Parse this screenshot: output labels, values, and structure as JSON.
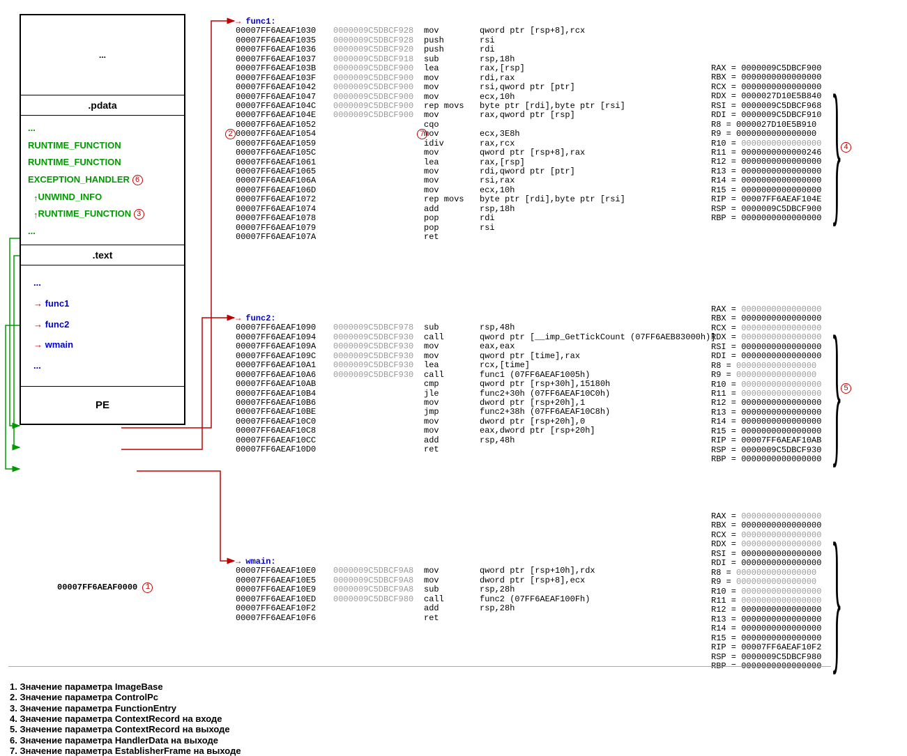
{
  "pe": {
    "dots": "...",
    "pdata_header": ".pdata",
    "pdata_items": [
      "...",
      "RUNTIME_FUNCTION",
      "RUNTIME_FUNCTION",
      "EXCEPTION_HANDLER",
      "UNWIND_INFO",
      "RUNTIME_FUNCTION",
      "..."
    ],
    "text_header": ".text",
    "text_items": [
      "...",
      "func1",
      "func2",
      "wmain",
      "..."
    ],
    "pe_label": "PE",
    "base_addr": "00007FF6AEAF0000"
  },
  "markers": {
    "m1": "1",
    "m2": "2",
    "m3": "3",
    "m4": "4",
    "m5": "5",
    "m6": "6",
    "m7": "7"
  },
  "func1": {
    "name": "func1:",
    "rows": [
      {
        "a": "00007FF6AEAF1030",
        "s": "0000009C5DBCF928",
        "op": "mov",
        "ar": "qword ptr [rsp+8],rcx"
      },
      {
        "a": "00007FF6AEAF1035",
        "s": "0000009C5DBCF928",
        "op": "push",
        "ar": "rsi"
      },
      {
        "a": "00007FF6AEAF1036",
        "s": "0000009C5DBCF920",
        "op": "push",
        "ar": "rdi"
      },
      {
        "a": "00007FF6AEAF1037",
        "s": "0000009C5DBCF918",
        "op": "sub",
        "ar": "rsp,18h"
      },
      {
        "a": "00007FF6AEAF103B",
        "s": "0000009C5DBCF900",
        "op": "lea",
        "ar": "rax,[rsp]"
      },
      {
        "a": "00007FF6AEAF103F",
        "s": "0000009C5DBCF900",
        "op": "mov",
        "ar": "rdi,rax"
      },
      {
        "a": "00007FF6AEAF1042",
        "s": "0000009C5DBCF900",
        "op": "mov",
        "ar": "rsi,qword ptr [ptr]"
      },
      {
        "a": "00007FF6AEAF1047",
        "s": "0000009C5DBCF900",
        "op": "mov",
        "ar": "ecx,10h"
      },
      {
        "a": "00007FF6AEAF104C",
        "s": "0000009C5DBCF900",
        "op": "rep movs",
        "ar": "byte ptr [rdi],byte ptr [rsi]"
      },
      {
        "a": "00007FF6AEAF104E",
        "s": "0000009C5DBCF900",
        "op": "mov",
        "ar": "rax,qword ptr [rsp]",
        "hl": true
      },
      {
        "a": "00007FF6AEAF1052",
        "s": "",
        "op": "cqo",
        "ar": ""
      },
      {
        "a": "00007FF6AEAF1054",
        "s": "",
        "op": "mov",
        "ar": "ecx,3E8h"
      },
      {
        "a": "00007FF6AEAF1059",
        "s": "",
        "op": "idiv",
        "ar": "rax,rcx"
      },
      {
        "a": "00007FF6AEAF105C",
        "s": "",
        "op": "mov",
        "ar": "qword ptr [rsp+8],rax"
      },
      {
        "a": "00007FF6AEAF1061",
        "s": "",
        "op": "lea",
        "ar": "rax,[rsp]"
      },
      {
        "a": "00007FF6AEAF1065",
        "s": "",
        "op": "mov",
        "ar": "rdi,qword ptr [ptr]"
      },
      {
        "a": "00007FF6AEAF106A",
        "s": "",
        "op": "mov",
        "ar": "rsi,rax"
      },
      {
        "a": "00007FF6AEAF106D",
        "s": "",
        "op": "mov",
        "ar": "ecx,10h"
      },
      {
        "a": "00007FF6AEAF1072",
        "s": "",
        "op": "rep movs",
        "ar": "byte ptr [rdi],byte ptr [rsi]"
      },
      {
        "a": "00007FF6AEAF1074",
        "s": "",
        "op": "add",
        "ar": "rsp,18h"
      },
      {
        "a": "00007FF6AEAF1078",
        "s": "",
        "op": "pop",
        "ar": "rdi"
      },
      {
        "a": "00007FF6AEAF1079",
        "s": "",
        "op": "pop",
        "ar": "rsi"
      },
      {
        "a": "00007FF6AEAF107A",
        "s": "",
        "op": "ret",
        "ar": ""
      }
    ]
  },
  "func2": {
    "name": "func2:",
    "rows": [
      {
        "a": "00007FF6AEAF1090",
        "s": "0000009C5DBCF978",
        "op": "sub",
        "ar": "rsp,48h"
      },
      {
        "a": "00007FF6AEAF1094",
        "s": "0000009C5DBCF930",
        "op": "call",
        "ar": "qword ptr [__imp_GetTickCount (07FF6AEB83000h)]"
      },
      {
        "a": "00007FF6AEAF109A",
        "s": "0000009C5DBCF930",
        "op": "mov",
        "ar": "eax,eax"
      },
      {
        "a": "00007FF6AEAF109C",
        "s": "0000009C5DBCF930",
        "op": "mov",
        "ar": "qword ptr [time],rax"
      },
      {
        "a": "00007FF6AEAF10A1",
        "s": "0000009C5DBCF930",
        "op": "lea",
        "ar": "rcx,[time]"
      },
      {
        "a": "00007FF6AEAF10A6",
        "s": "0000009C5DBCF930",
        "op": "call",
        "ar": "func1 (07FF6AEAF1005h)"
      },
      {
        "a": "00007FF6AEAF10AB",
        "s": "",
        "op": "cmp",
        "ar": "qword ptr [rsp+30h],15180h"
      },
      {
        "a": "00007FF6AEAF10B4",
        "s": "",
        "op": "jle",
        "ar": "func2+30h (07FF6AEAF10C0h)"
      },
      {
        "a": "00007FF6AEAF10B6",
        "s": "",
        "op": "mov",
        "ar": "dword ptr [rsp+20h],1"
      },
      {
        "a": "00007FF6AEAF10BE",
        "s": "",
        "op": "jmp",
        "ar": "func2+38h (07FF6AEAF10C8h)"
      },
      {
        "a": "00007FF6AEAF10C0",
        "s": "",
        "op": "mov",
        "ar": "dword ptr [rsp+20h],0"
      },
      {
        "a": "00007FF6AEAF10C8",
        "s": "",
        "op": "mov",
        "ar": "eax,dword ptr [rsp+20h]"
      },
      {
        "a": "00007FF6AEAF10CC",
        "s": "",
        "op": "add",
        "ar": "rsp,48h"
      },
      {
        "a": "00007FF6AEAF10D0",
        "s": "",
        "op": "ret",
        "ar": ""
      }
    ]
  },
  "wmain": {
    "name": "wmain:",
    "rows": [
      {
        "a": "00007FF6AEAF10E0",
        "s": "0000009C5DBCF9A8",
        "op": "mov",
        "ar": "qword ptr [rsp+10h],rdx"
      },
      {
        "a": "00007FF6AEAF10E5",
        "s": "0000009C5DBCF9A8",
        "op": "mov",
        "ar": "dword ptr [rsp+8],ecx"
      },
      {
        "a": "00007FF6AEAF10E9",
        "s": "0000009C5DBCF9A8",
        "op": "sub",
        "ar": "rsp,28h"
      },
      {
        "a": "00007FF6AEAF10ED",
        "s": "0000009C5DBCF980",
        "op": "call",
        "ar": "func2 (07FF6AEAF100Fh)"
      },
      {
        "a": "00007FF6AEAF10F2",
        "s": "",
        "op": "add",
        "ar": "rsp,28h"
      },
      {
        "a": "00007FF6AEAF10F6",
        "s": "",
        "op": "ret",
        "ar": ""
      }
    ]
  },
  "regs1": [
    {
      "n": "RAX",
      "v": "0000009C5DBCF900"
    },
    {
      "n": "RBX",
      "v": "0000000000000000"
    },
    {
      "n": "RCX",
      "v": "0000000000000000"
    },
    {
      "n": "RDX",
      "v": "0000027D10E5B840"
    },
    {
      "n": "RSI",
      "v": "0000009C5DBCF968"
    },
    {
      "n": "RDI",
      "v": "0000009C5DBCF910"
    },
    {
      "n": "R8 ",
      "v": "0000027D10E5B910"
    },
    {
      "n": "R9 ",
      "v": "0000000000000000"
    },
    {
      "n": "R10",
      "v": "0000000000000000",
      "z": true
    },
    {
      "n": "R11",
      "v": "0000000000000246"
    },
    {
      "n": "R12",
      "v": "0000000000000000"
    },
    {
      "n": "R13",
      "v": "0000000000000000"
    },
    {
      "n": "R14",
      "v": "0000000000000000"
    },
    {
      "n": "R15",
      "v": "0000000000000000"
    },
    {
      "n": "RIP",
      "v": "00007FF6AEAF104E"
    },
    {
      "n": "RSP",
      "v": "0000009C5DBCF900"
    },
    {
      "n": "RBP",
      "v": "0000000000000000"
    }
  ],
  "regs2": [
    {
      "n": "RAX",
      "v": "0000000000000000",
      "z": true
    },
    {
      "n": "RBX",
      "v": "0000000000000000"
    },
    {
      "n": "RCX",
      "v": "0000000000000000",
      "z": true
    },
    {
      "n": "RDX",
      "v": "0000000000000000",
      "z": true
    },
    {
      "n": "RSI",
      "v": "0000000000000000"
    },
    {
      "n": "RDI",
      "v": "0000000000000000"
    },
    {
      "n": "R8 ",
      "v": "0000000000000000",
      "z": true
    },
    {
      "n": "R9 ",
      "v": "0000000000000000",
      "z": true
    },
    {
      "n": "R10",
      "v": "0000000000000000",
      "z": true
    },
    {
      "n": "R11",
      "v": "0000000000000000",
      "z": true
    },
    {
      "n": "R12",
      "v": "0000000000000000"
    },
    {
      "n": "R13",
      "v": "0000000000000000"
    },
    {
      "n": "R14",
      "v": "0000000000000000"
    },
    {
      "n": "R15",
      "v": "0000000000000000"
    },
    {
      "n": "RIP",
      "v": "00007FF6AEAF10AB"
    },
    {
      "n": "RSP",
      "v": "0000009C5DBCF930"
    },
    {
      "n": "RBP",
      "v": "0000000000000000"
    }
  ],
  "regs3": [
    {
      "n": "RAX",
      "v": "0000000000000000",
      "z": true
    },
    {
      "n": "RBX",
      "v": "0000000000000000"
    },
    {
      "n": "RCX",
      "v": "0000000000000000",
      "z": true
    },
    {
      "n": "RDX",
      "v": "0000000000000000",
      "z": true
    },
    {
      "n": "RSI",
      "v": "0000000000000000"
    },
    {
      "n": "RDI",
      "v": "0000000000000000"
    },
    {
      "n": "R8 ",
      "v": "0000000000000000",
      "z": true
    },
    {
      "n": "R9 ",
      "v": "0000000000000000",
      "z": true
    },
    {
      "n": "R10",
      "v": "0000000000000000",
      "z": true
    },
    {
      "n": "R11",
      "v": "0000000000000000",
      "z": true
    },
    {
      "n": "R12",
      "v": "0000000000000000"
    },
    {
      "n": "R13",
      "v": "0000000000000000"
    },
    {
      "n": "R14",
      "v": "0000000000000000"
    },
    {
      "n": "R15",
      "v": "0000000000000000"
    },
    {
      "n": "RIP",
      "v": "00007FF6AEAF10F2"
    },
    {
      "n": "RSP",
      "v": "0000009C5DBCF980"
    },
    {
      "n": "RBP",
      "v": "0000000000000000"
    }
  ],
  "legend": [
    "1. Значение параметра ImageBase",
    "2. Значение параметра ControlPc",
    "3. Значение параметра FunctionEntry",
    "4. Значение параметра ContextRecord на входе",
    "5. Значение параметра ContextRecord на выходе",
    "6. Значение параметра HandlerData на выходе",
    "7. Значение параметра EstablisherFrame на выходе"
  ]
}
